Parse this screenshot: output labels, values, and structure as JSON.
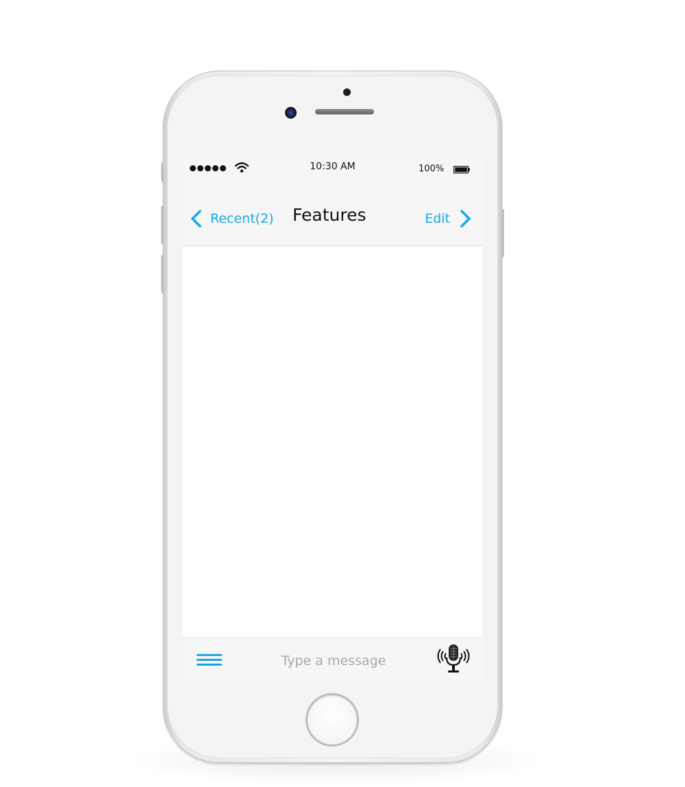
{
  "status_bar": {
    "time": "10:30 AM",
    "battery_percent": "100%",
    "signal_dots": 5,
    "icons": [
      "signal-dots-icon",
      "wifi-icon",
      "battery-icon"
    ]
  },
  "nav": {
    "back_label": "Recent(2)",
    "title": "Features",
    "edit_label": "Edit",
    "icons": [
      "chevron-left-icon",
      "chevron-right-icon"
    ]
  },
  "composer": {
    "placeholder": "Type a message",
    "value": "",
    "icons": [
      "hamburger-menu-icon",
      "microphone-icon"
    ]
  },
  "colors": {
    "accent": "#1aa7e6",
    "bar_background": "#f5f6f5",
    "phone_body": "#f3f4f3",
    "text": "#111111",
    "placeholder": "#a9a9a9"
  }
}
